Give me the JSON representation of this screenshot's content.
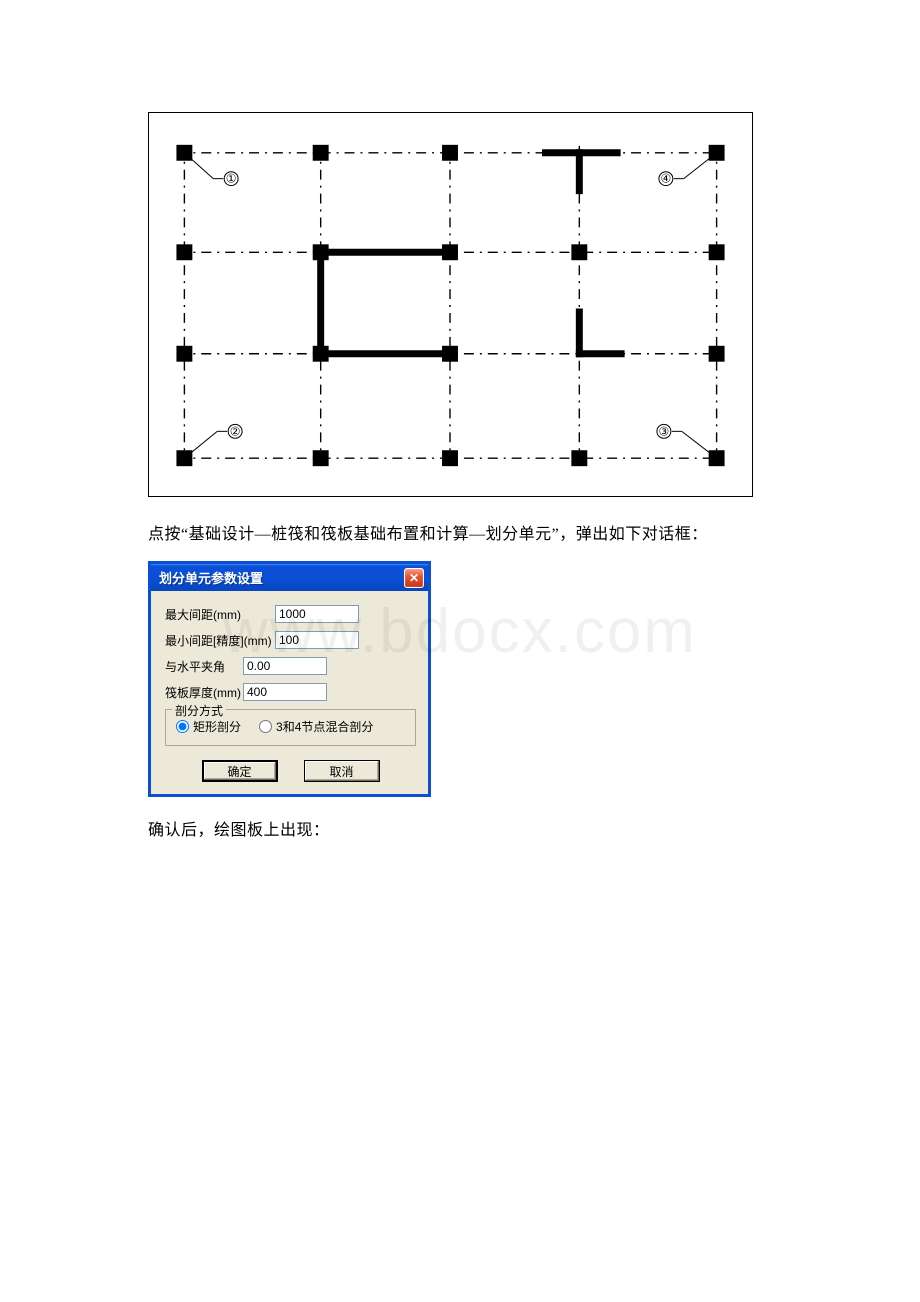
{
  "watermark": "www.bdocx.com",
  "text": {
    "caption1": "点按“基础设计—桩筏和筏板基础布置和计算—划分单元”，弹出如下对话框：",
    "caption2": "确认后，绘图板上出现："
  },
  "diagram": {
    "labels": [
      "①",
      "②",
      "③",
      "④"
    ]
  },
  "dialog": {
    "title": "划分单元参数设置",
    "close": "✕",
    "fields": {
      "max_spacing": {
        "label": "最大间距(mm)",
        "value": "1000"
      },
      "min_spacing": {
        "label": "最小间距[精度](mm)",
        "value": "100"
      },
      "angle": {
        "label": "与水平夹角",
        "value": "0.00"
      },
      "thickness": {
        "label": "筏板厚度(mm)",
        "value": "400"
      }
    },
    "group": {
      "legend": "剖分方式",
      "opt1": "矩形剖分",
      "opt2": "3和4节点混合剖分"
    },
    "buttons": {
      "ok": "确定",
      "cancel": "取消"
    }
  }
}
